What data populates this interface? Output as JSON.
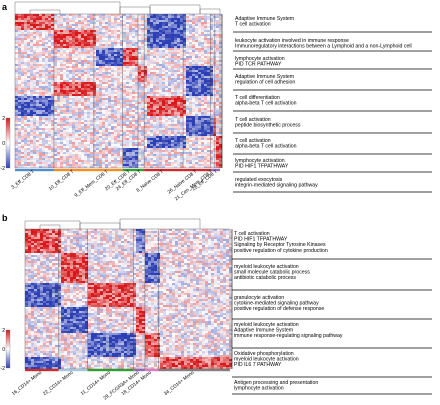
{
  "chart_data": [
    {
      "type": "heatmap",
      "panel_label": "a",
      "columns": [
        "3_Eff_CD8 T",
        "10_Eff_CD8 T",
        "9_Eff_Mem_CD8 T",
        "20_Eff_CD8 T",
        "24_Eff_CD8 T",
        "8_Naive CD8 T",
        "26_Naive CD8 T",
        "21_Cen_Mem_CD8 T",
        "28_Eff_CD8 T"
      ],
      "column_bar_colors": [
        "#4a8fd0",
        "#ff8c1a",
        "#ff8c1a",
        "#2ca02c",
        "#2ca02c",
        "#d62728",
        "#d62728",
        "#9467bd",
        "#9467bd"
      ],
      "color_scale": {
        "ticks": [
          "2",
          "0",
          "-2"
        ],
        "colors": [
          "#d7191c",
          "#ffffff",
          "#2c3fb4"
        ]
      },
      "annotations": [
        [
          "Adaptive Immune System",
          "T cell activation"
        ],
        [
          "leukocyte activation involved in immune response",
          "Immunoregulatory interactions between a Lymphoid and a non-Lymphoid cell"
        ],
        [
          "lymphocyte activation",
          "PID TCR PATHWAY"
        ],
        [
          "Adaptive Immune System",
          "regulation of cell adhesion"
        ],
        [
          "T cell differentiation",
          "alpha-beta T cell activation"
        ],
        [
          "T cell activation",
          "peptide biosynthetic process"
        ],
        [
          "T cell activation",
          "alpha-beta T cell activation"
        ],
        [
          "lymphocyte activation",
          "PID HIF1 TFPATHWAY"
        ],
        [
          "regulated exocytosis",
          "integrin-mediated signaling pathway"
        ]
      ]
    },
    {
      "type": "heatmap",
      "panel_label": "b",
      "columns": [
        "16_CD14+ Mono",
        "22_CD14+ Mono",
        "11_CD14+ Mono",
        "29_FCGR3A+ Mono",
        "18_CD14+ Mono",
        "34_CD14+ Mono"
      ],
      "column_bar_colors": [
        "#d62728",
        "#9ecae1",
        "#2ca02c",
        "#9467bd",
        "#e377c2",
        "#7f7f7f"
      ],
      "color_scale": {
        "ticks": [
          "2",
          "0",
          "-2"
        ],
        "colors": [
          "#d7191c",
          "#ffffff",
          "#2c3fb4"
        ]
      },
      "annotations": [
        [
          "T cell activation",
          "PID HIF1 TFPATHWAY",
          "Signaling by Receptor Tyrosine Kinases",
          "positive regulation of cytokine production"
        ],
        [
          "myeloid leukocyte activation",
          "small molecule catabolic process",
          "antibiotic catabolic process"
        ],
        [
          "granulocyte activation",
          "cytokine-mediated signaling pathway",
          "positive regulation of defense response"
        ],
        [
          "myeloid leukocyte activation",
          "Adaptive Immune System",
          "immune response-regulating signaling pathway"
        ],
        [
          "Oxidative phosphorylation",
          "myeloid leukocyte activation",
          "PID IL6 7 PATHWAY"
        ],
        [
          "Antigen processing and presentation",
          "lymphocyte activation"
        ]
      ]
    }
  ]
}
